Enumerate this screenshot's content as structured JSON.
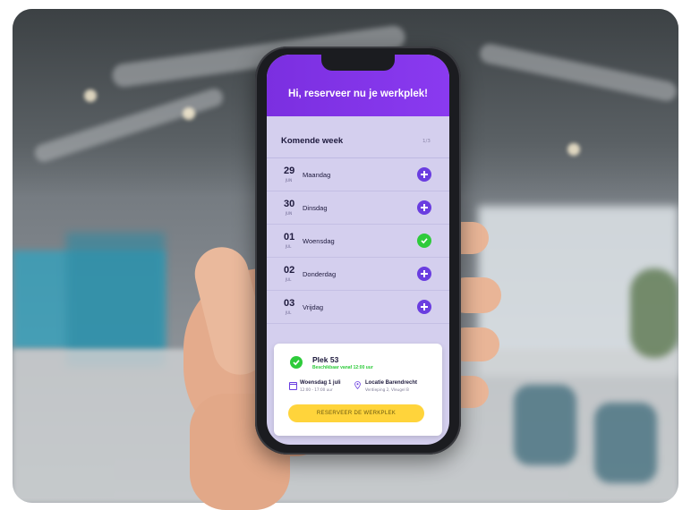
{
  "app": {
    "header_title": "Hi, reserveer nu je werkplek!",
    "week_title": "Komende week",
    "week_count": "1/3"
  },
  "days": [
    {
      "num": "29",
      "month": "JUN",
      "name": "Maandag",
      "status": "available",
      "icon": "plus-icon"
    },
    {
      "num": "30",
      "month": "JUN",
      "name": "Dinsdag",
      "status": "available",
      "icon": "plus-icon"
    },
    {
      "num": "01",
      "month": "JUL",
      "name": "Woensdag",
      "status": "selected",
      "icon": "check-icon"
    },
    {
      "num": "02",
      "month": "JUL",
      "name": "Donderdag",
      "status": "available",
      "icon": "plus-icon"
    },
    {
      "num": "03",
      "month": "JUL",
      "name": "Vrijdag",
      "status": "available",
      "icon": "plus-icon"
    }
  ],
  "card": {
    "title": "Plek 53",
    "subtitle": "Beschikbaar vanaf 12:00 uur",
    "date_main": "Woensdag 1 juli",
    "date_sub": "12:00 - 17:00 uur",
    "location_main": "Locatie Barendrecht",
    "location_sub": "Verdieping 2, Vleugel B",
    "cta_label": "RESERVEER DE WERKPLEK"
  },
  "colors": {
    "header_purple": "#7b2fe0",
    "screen_lavender": "#d4cfee",
    "button_purple": "#6a3de0",
    "success_green": "#2ecb3b",
    "cta_yellow": "#ffd43b"
  }
}
